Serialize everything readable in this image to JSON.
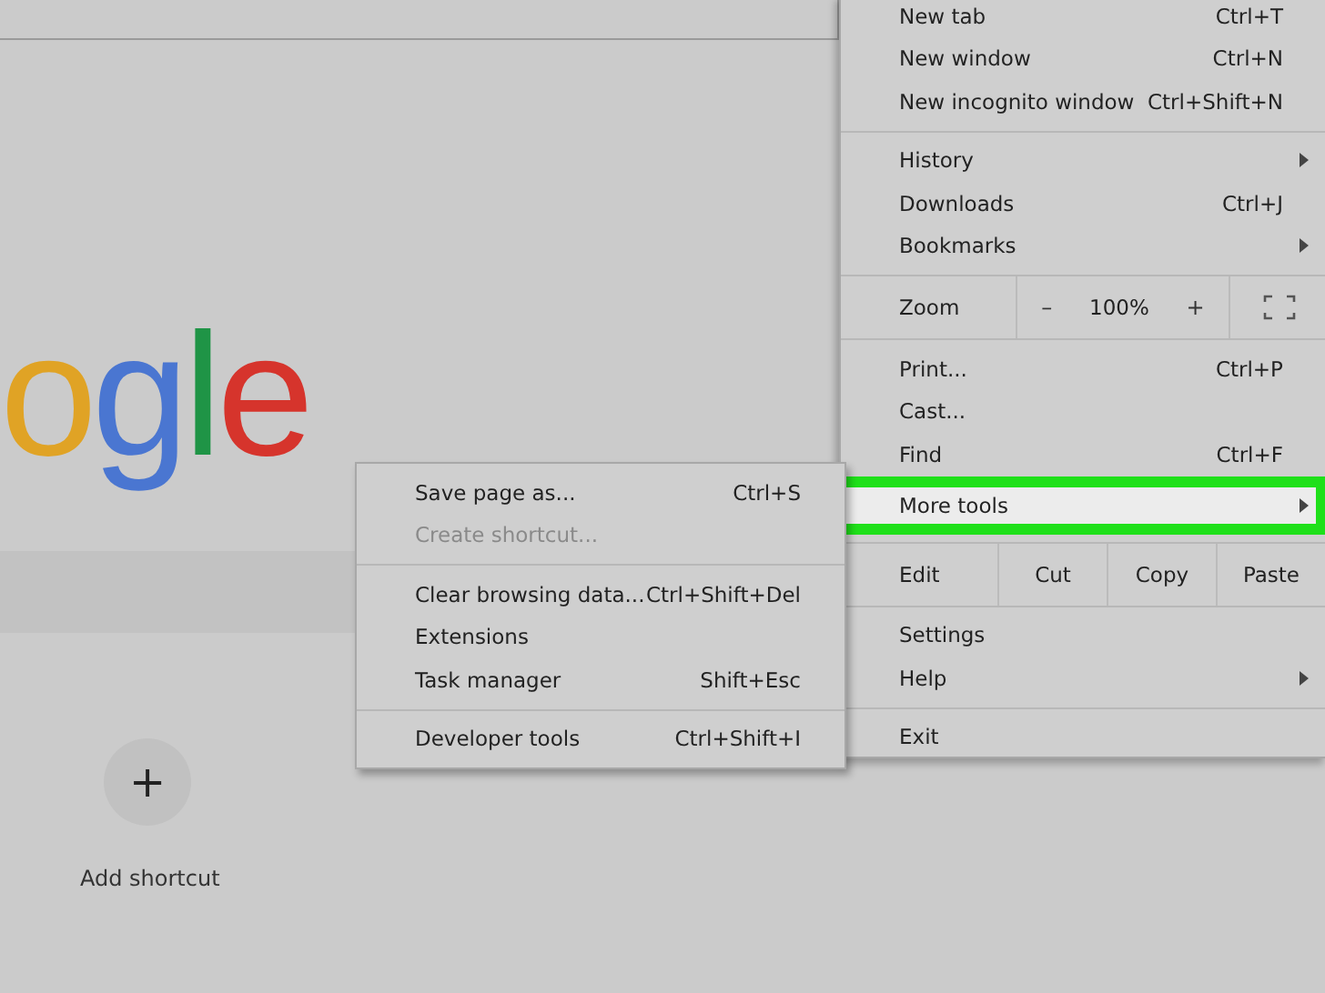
{
  "logo": [
    {
      "text": "o",
      "color": "#e0a325"
    },
    {
      "text": "g",
      "color": "#4a76d1"
    },
    {
      "text": "l",
      "color": "#1f9446"
    },
    {
      "text": "e",
      "color": "#d6342c"
    }
  ],
  "add_shortcut": {
    "icon": "+",
    "label": "Add shortcut"
  },
  "menu": {
    "groups": [
      [
        {
          "kind": "item",
          "label": "New tab",
          "shortcut": "Ctrl+T",
          "has_submenu": false,
          "selected": false
        },
        {
          "kind": "item",
          "label": "New window",
          "shortcut": "Ctrl+N",
          "has_submenu": false,
          "selected": false
        },
        {
          "kind": "item",
          "label": "New incognito window",
          "shortcut": "Ctrl+Shift+N",
          "has_submenu": false,
          "selected": false
        }
      ],
      [
        {
          "kind": "item",
          "label": "History",
          "has_submenu": true,
          "selected": false
        },
        {
          "kind": "item",
          "label": "Downloads",
          "shortcut": "Ctrl+J",
          "has_submenu": false,
          "selected": false
        },
        {
          "kind": "item",
          "label": "Bookmarks",
          "has_submenu": true,
          "selected": false
        }
      ],
      [
        {
          "kind": "zoom",
          "label": "Zoom",
          "minus": "–",
          "value": "100%",
          "plus": "+"
        }
      ],
      [
        {
          "kind": "item",
          "label": "Print...",
          "shortcut": "Ctrl+P",
          "has_submenu": false,
          "selected": false
        },
        {
          "kind": "item",
          "label": "Cast...",
          "has_submenu": false,
          "selected": false
        },
        {
          "kind": "item",
          "label": "Find",
          "shortcut": "Ctrl+F",
          "has_submenu": false,
          "selected": false
        },
        {
          "kind": "item",
          "label": "More tools",
          "has_submenu": true,
          "selected": true
        }
      ],
      [
        {
          "kind": "edit",
          "label": "Edit",
          "buttons": [
            "Cut",
            "Copy",
            "Paste"
          ]
        }
      ],
      [
        {
          "kind": "item",
          "label": "Settings",
          "has_submenu": false,
          "selected": false
        },
        {
          "kind": "item",
          "label": "Help",
          "has_submenu": true,
          "selected": false
        }
      ],
      [
        {
          "kind": "item",
          "label": "Exit",
          "has_submenu": false,
          "selected": false
        }
      ]
    ]
  },
  "submenu": {
    "groups": [
      [
        {
          "label": "Save page as...",
          "shortcut": "Ctrl+S",
          "disabled": false
        },
        {
          "label": "Create shortcut...",
          "disabled": true
        }
      ],
      [
        {
          "label": "Clear browsing data...",
          "shortcut": "Ctrl+Shift+Del",
          "disabled": false
        },
        {
          "label": "Extensions",
          "disabled": false
        },
        {
          "label": "Task manager",
          "shortcut": "Shift+Esc",
          "disabled": false
        }
      ],
      [
        {
          "label": "Developer tools",
          "shortcut": "Ctrl+Shift+I",
          "disabled": false
        }
      ]
    ]
  }
}
